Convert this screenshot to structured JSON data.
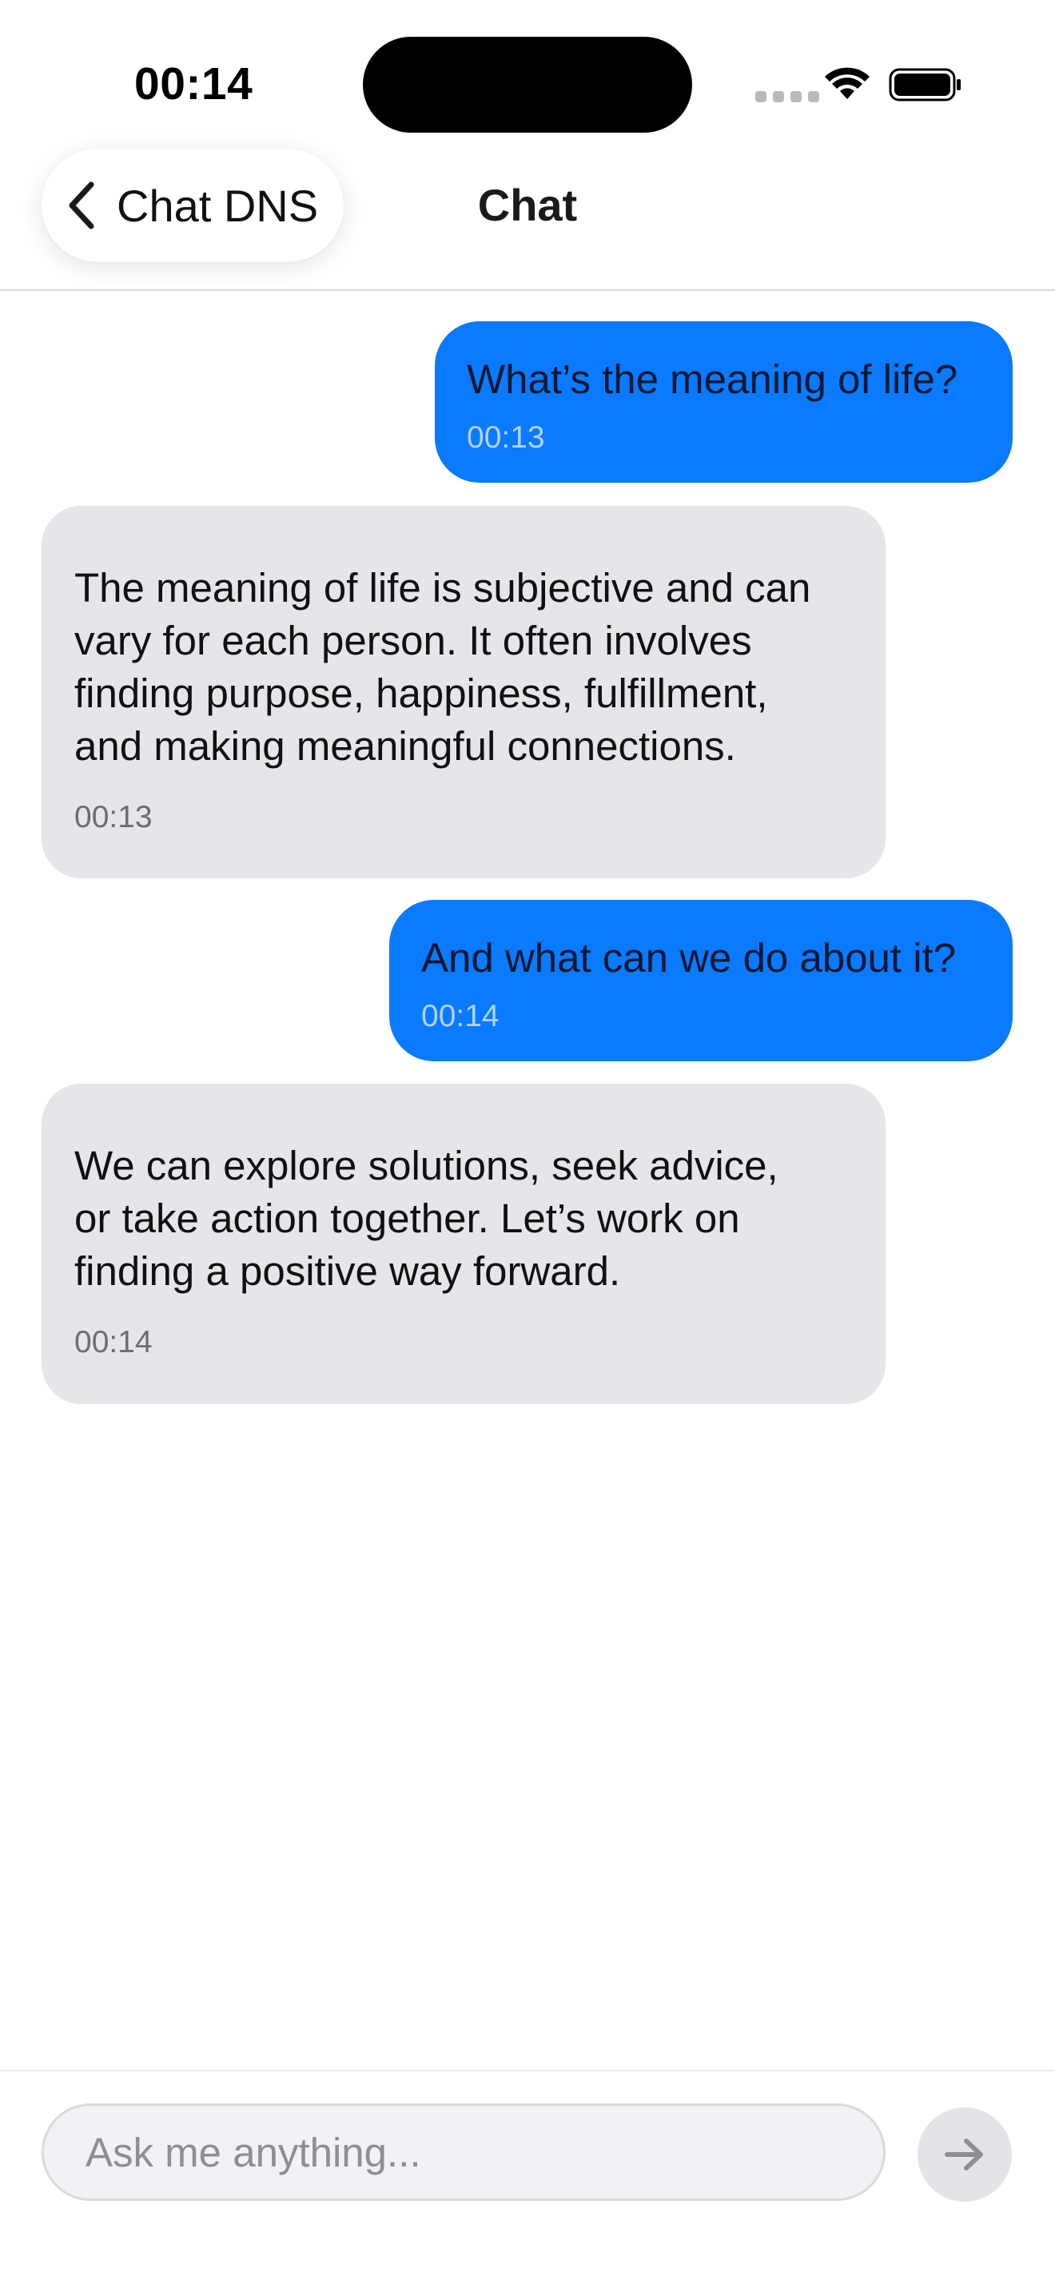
{
  "status_bar": {
    "time": "00:14"
  },
  "nav": {
    "back_label": "Chat DNS",
    "title": "Chat"
  },
  "messages": [
    {
      "role": "user",
      "text": "What’s the meaning of life?",
      "time": "00:13"
    },
    {
      "role": "assistant",
      "text": "The meaning of life is subjective and can\nvary for each person. It often involves\nfinding purpose, happiness, fulfillment,\nand making meaningful connections.",
      "time": "00:13"
    },
    {
      "role": "user",
      "text": "And what can we do about it?",
      "time": "00:14"
    },
    {
      "role": "assistant",
      "text": "We can explore solutions, seek advice,\nor take action together. Let’s work on\nfinding a positive way forward.",
      "time": "00:14"
    }
  ],
  "composer": {
    "placeholder": "Ask me anything..."
  },
  "colors": {
    "user_bubble": "#0a7aff",
    "assistant_bubble": "#e5e5ea",
    "send_button": "#e3e3e8"
  },
  "icons": {
    "back": "chevron-left-icon",
    "send": "arrow-right-icon",
    "wifi": "wifi-icon",
    "battery": "battery-icon",
    "signal": "signal-icon"
  }
}
